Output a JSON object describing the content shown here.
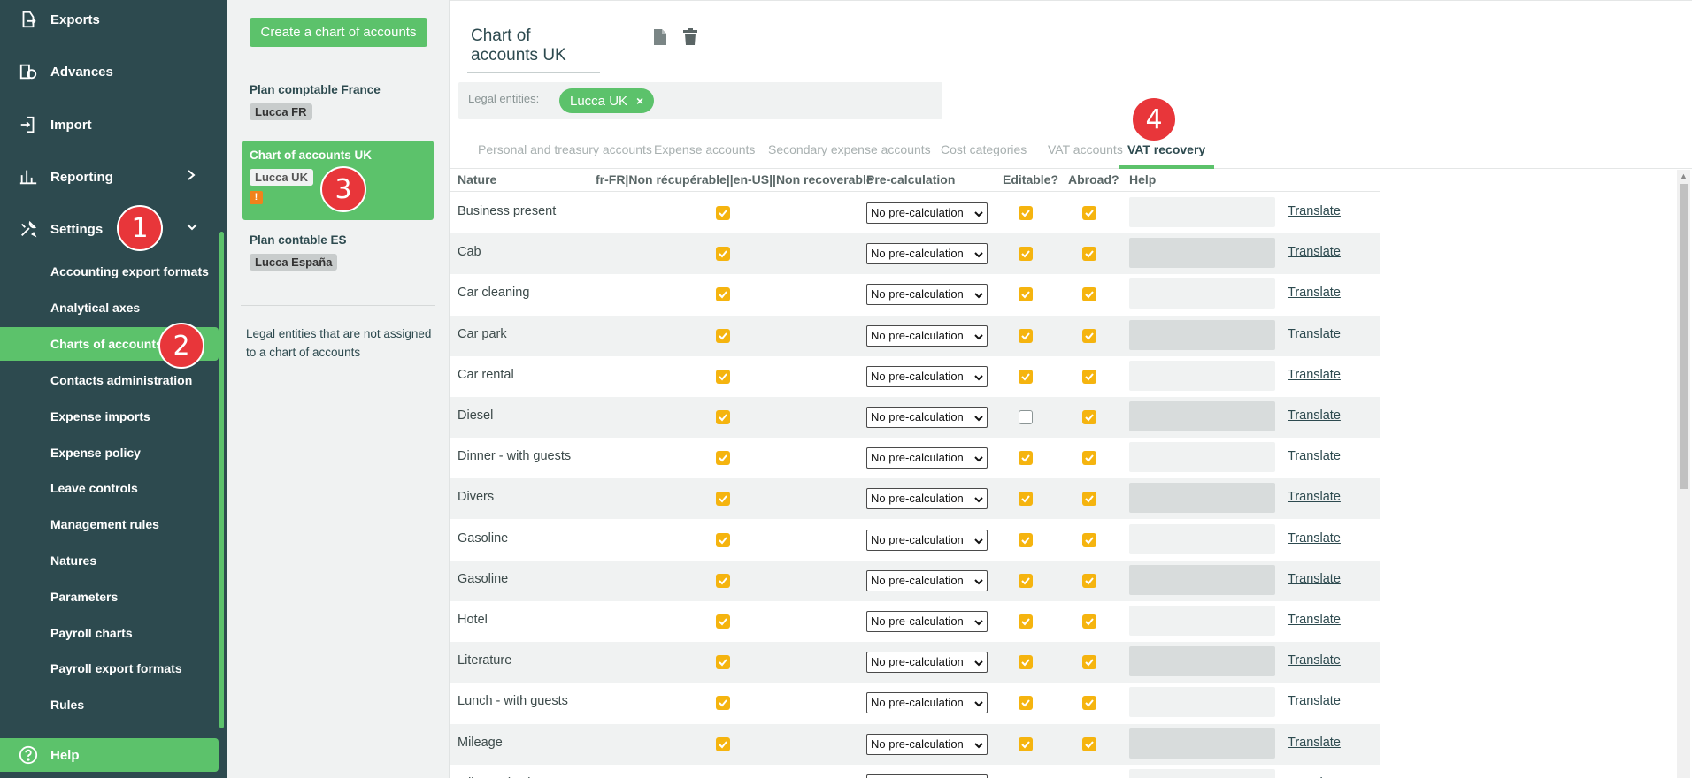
{
  "sidebar": {
    "items": [
      {
        "label": "Exports",
        "icon": "exports-icon"
      },
      {
        "label": "Advances",
        "icon": "advances-icon"
      },
      {
        "label": "Import",
        "icon": "import-icon"
      },
      {
        "label": "Reporting",
        "icon": "reporting-icon"
      },
      {
        "label": "Settings",
        "icon": "settings-icon"
      }
    ],
    "settings_sub": [
      "Accounting export formats",
      "Analytical axes",
      "Charts of accounts",
      "Contacts administration",
      "Expense imports",
      "Expense policy",
      "Leave controls",
      "Management rules",
      "Natures",
      "Parameters",
      "Payroll charts",
      "Payroll export formats",
      "Rules"
    ],
    "help_label": "Help"
  },
  "badges": [
    "1",
    "2",
    "3",
    "4"
  ],
  "midcol": {
    "create_label": "Create a chart of accounts",
    "charts": [
      {
        "title": "Plan comptable France",
        "tag": "Lucca FR"
      },
      {
        "title": "Chart of accounts UK",
        "tag": "Lucca UK",
        "warning": "!"
      },
      {
        "title": "Plan contable ES",
        "tag": "Lucca España"
      }
    ],
    "unassigned_text": "Legal entities that are not assigned to a chart of accounts"
  },
  "main": {
    "name": "Chart of accounts UK",
    "legal_label": "Legal entities:",
    "legal_chip": "Lucca UK",
    "chip_remove": "×",
    "tabs": [
      "Personal and treasury accounts",
      "Expense accounts",
      "Secondary expense accounts",
      "Cost categories",
      "VAT accounts",
      "VAT recovery"
    ]
  },
  "table": {
    "headers": {
      "nature": "Nature",
      "recoverable": "fr-FR|Non récupérable||en-US||Non recoverable",
      "precalc": "Pre-calculation",
      "editable": "Editable?",
      "abroad": "Abroad?",
      "help": "Help"
    },
    "select_value": "No pre-calculation",
    "translate_label": "Translate",
    "rows": [
      {
        "nature": "Business present",
        "recoverable": true,
        "editable": true,
        "abroad": true
      },
      {
        "nature": "Cab",
        "recoverable": true,
        "editable": true,
        "abroad": true
      },
      {
        "nature": "Car cleaning",
        "recoverable": true,
        "editable": true,
        "abroad": true
      },
      {
        "nature": "Car park",
        "recoverable": true,
        "editable": true,
        "abroad": true
      },
      {
        "nature": "Car rental",
        "recoverable": true,
        "editable": true,
        "abroad": true
      },
      {
        "nature": "Diesel",
        "recoverable": true,
        "editable": false,
        "abroad": true
      },
      {
        "nature": "Dinner - with guests",
        "recoverable": true,
        "editable": true,
        "abroad": true
      },
      {
        "nature": "Divers",
        "recoverable": true,
        "editable": true,
        "abroad": true
      },
      {
        "nature": "Gasoline",
        "recoverable": true,
        "editable": true,
        "abroad": true
      },
      {
        "nature": "Gasoline",
        "recoverable": true,
        "editable": true,
        "abroad": true
      },
      {
        "nature": "Hotel",
        "recoverable": true,
        "editable": true,
        "abroad": true
      },
      {
        "nature": "Literature",
        "recoverable": true,
        "editable": true,
        "abroad": true
      },
      {
        "nature": "Lunch - with guests",
        "recoverable": true,
        "editable": true,
        "abroad": true
      },
      {
        "nature": "Mileage",
        "recoverable": true,
        "editable": true,
        "abroad": true
      },
      {
        "nature": "Mileage (UK)",
        "recoverable": true,
        "editable": true,
        "abroad": true
      }
    ]
  },
  "colors": {
    "sidebar_bg": "#2d4a4f",
    "accent_green": "#5cc26b",
    "checkbox": "#f5b40f",
    "badge_red": "#e8363a",
    "warning_orange": "#f0821c"
  }
}
